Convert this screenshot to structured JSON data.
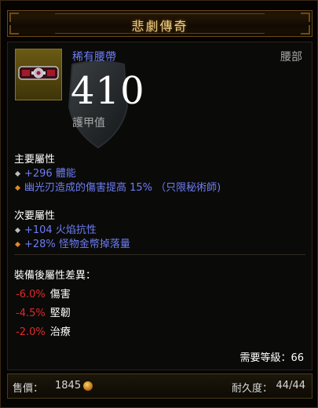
{
  "header": {
    "title": "悲劇傳奇"
  },
  "item": {
    "type": "稀有腰帶",
    "slot": "腰部",
    "armor_value": "410",
    "armor_label": "護甲值",
    "icon": "belt-icon",
    "shield_icon": "shield-icon"
  },
  "primary": {
    "title": "主要屬性",
    "stats": [
      {
        "text": "+296 體能",
        "bullet": "white"
      },
      {
        "text": "幽光刃造成的傷害提高 15% （只限秘術師)",
        "bullet": "orange"
      }
    ]
  },
  "secondary": {
    "title": "次要屬性",
    "stats": [
      {
        "text": "+104 火焰抗性",
        "bullet": "white"
      },
      {
        "text": "+28% 怪物金幣掉落量",
        "bullet": "orange"
      }
    ]
  },
  "diff": {
    "title": "裝備後屬性差異：",
    "rows": [
      {
        "value": "-6.0%",
        "label": "傷害"
      },
      {
        "value": "-4.5%",
        "label": "堅韌"
      },
      {
        "value": "-2.0%",
        "label": "治療"
      }
    ]
  },
  "requirement": "需要等級：66",
  "footer": {
    "price_label": "售價：",
    "price_value": "1845",
    "coin_icon": "gold-coin-icon",
    "durability_label": "耐久度：",
    "durability_value": "44/44"
  },
  "colors": {
    "rare_blue": "#6d7df2",
    "negative_red": "#e02a2a",
    "gold_title": "#efd08a",
    "affix_orange": "#e08a22"
  }
}
